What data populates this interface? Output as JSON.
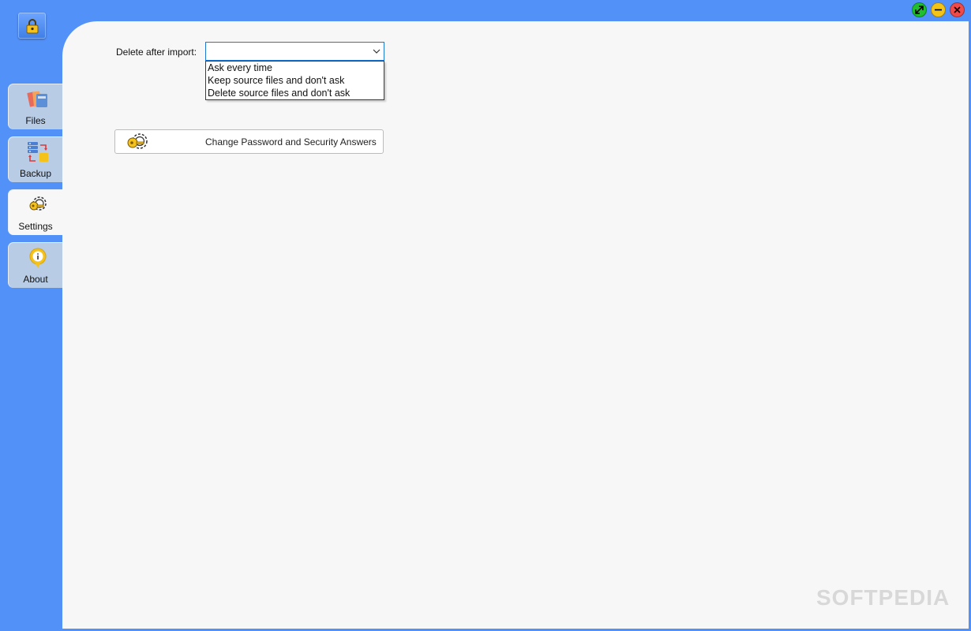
{
  "nav": {
    "tabs": [
      {
        "label": "Files",
        "icon": "files-icon"
      },
      {
        "label": "Backup",
        "icon": "backup-icon"
      },
      {
        "label": "Settings",
        "icon": "settings-key-icon",
        "active": true
      },
      {
        "label": "About",
        "icon": "info-icon"
      }
    ]
  },
  "window_controls": {
    "maximize_color": "#1fbf2f",
    "minimize_color": "#f2c318",
    "close_color": "#ee4b4b"
  },
  "settings": {
    "delete_label": "Delete after import:",
    "delete_value": "",
    "delete_options": [
      "Ask every time",
      "Keep source files and don't ask",
      "Delete source files and don't ask"
    ],
    "change_password_label": "Change Password and Security Answers"
  },
  "watermark": "SOFTPEDIA",
  "colors": {
    "frame": "#5291f8",
    "content_bg": "#f7f7f7",
    "tab_inactive": "#b8cce6",
    "combo_border": "#1e78d3"
  }
}
